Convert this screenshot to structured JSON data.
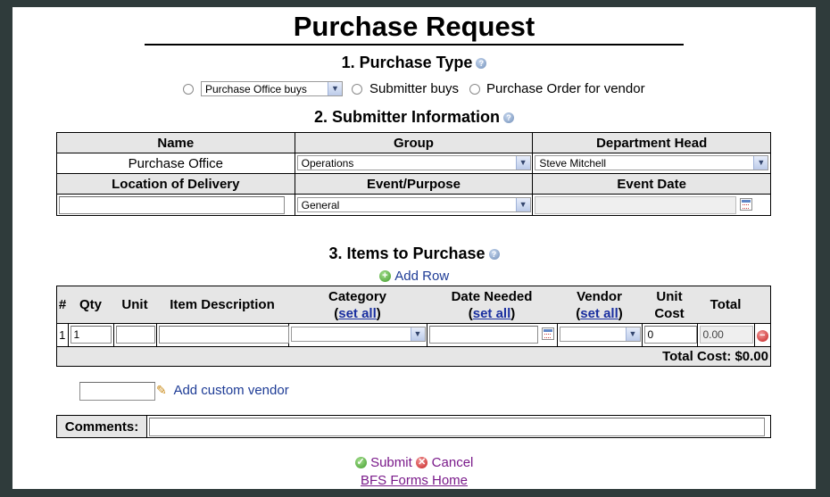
{
  "title": "Purchase Request",
  "section1": {
    "heading": "1. Purchase Type",
    "select_value": "Purchase Office buys",
    "option2": "Submitter buys",
    "option3": "Purchase Order for vendor"
  },
  "section2": {
    "heading": "2. Submitter Information",
    "col_name": "Name",
    "col_group": "Group",
    "col_dept_head": "Department Head",
    "name_value": "Purchase Office",
    "group_value": "Operations",
    "dept_head_value": "Steve Mitchell",
    "col_location": "Location of Delivery",
    "col_event": "Event/Purpose",
    "col_event_date": "Event Date",
    "event_value": "General"
  },
  "section3": {
    "heading": "3. Items to Purchase",
    "add_row": "Add Row",
    "columns": {
      "num": "#",
      "qty": "Qty",
      "unit": "Unit",
      "desc": "Item Description",
      "category": "Category",
      "date_needed": "Date Needed",
      "vendor": "Vendor",
      "unit_cost_1": "Unit",
      "unit_cost_2": "Cost",
      "total": "Total",
      "set_all": "set all"
    },
    "row": {
      "num": "1",
      "qty": "1",
      "unit_cost": "0",
      "total": "0.00"
    },
    "total_cost_label": "Total Cost: $0.00"
  },
  "custom_vendor": "Add custom vendor",
  "comments_label": "Comments:",
  "submit": "Submit",
  "cancel": "Cancel",
  "home_link": "BFS Forms Home"
}
